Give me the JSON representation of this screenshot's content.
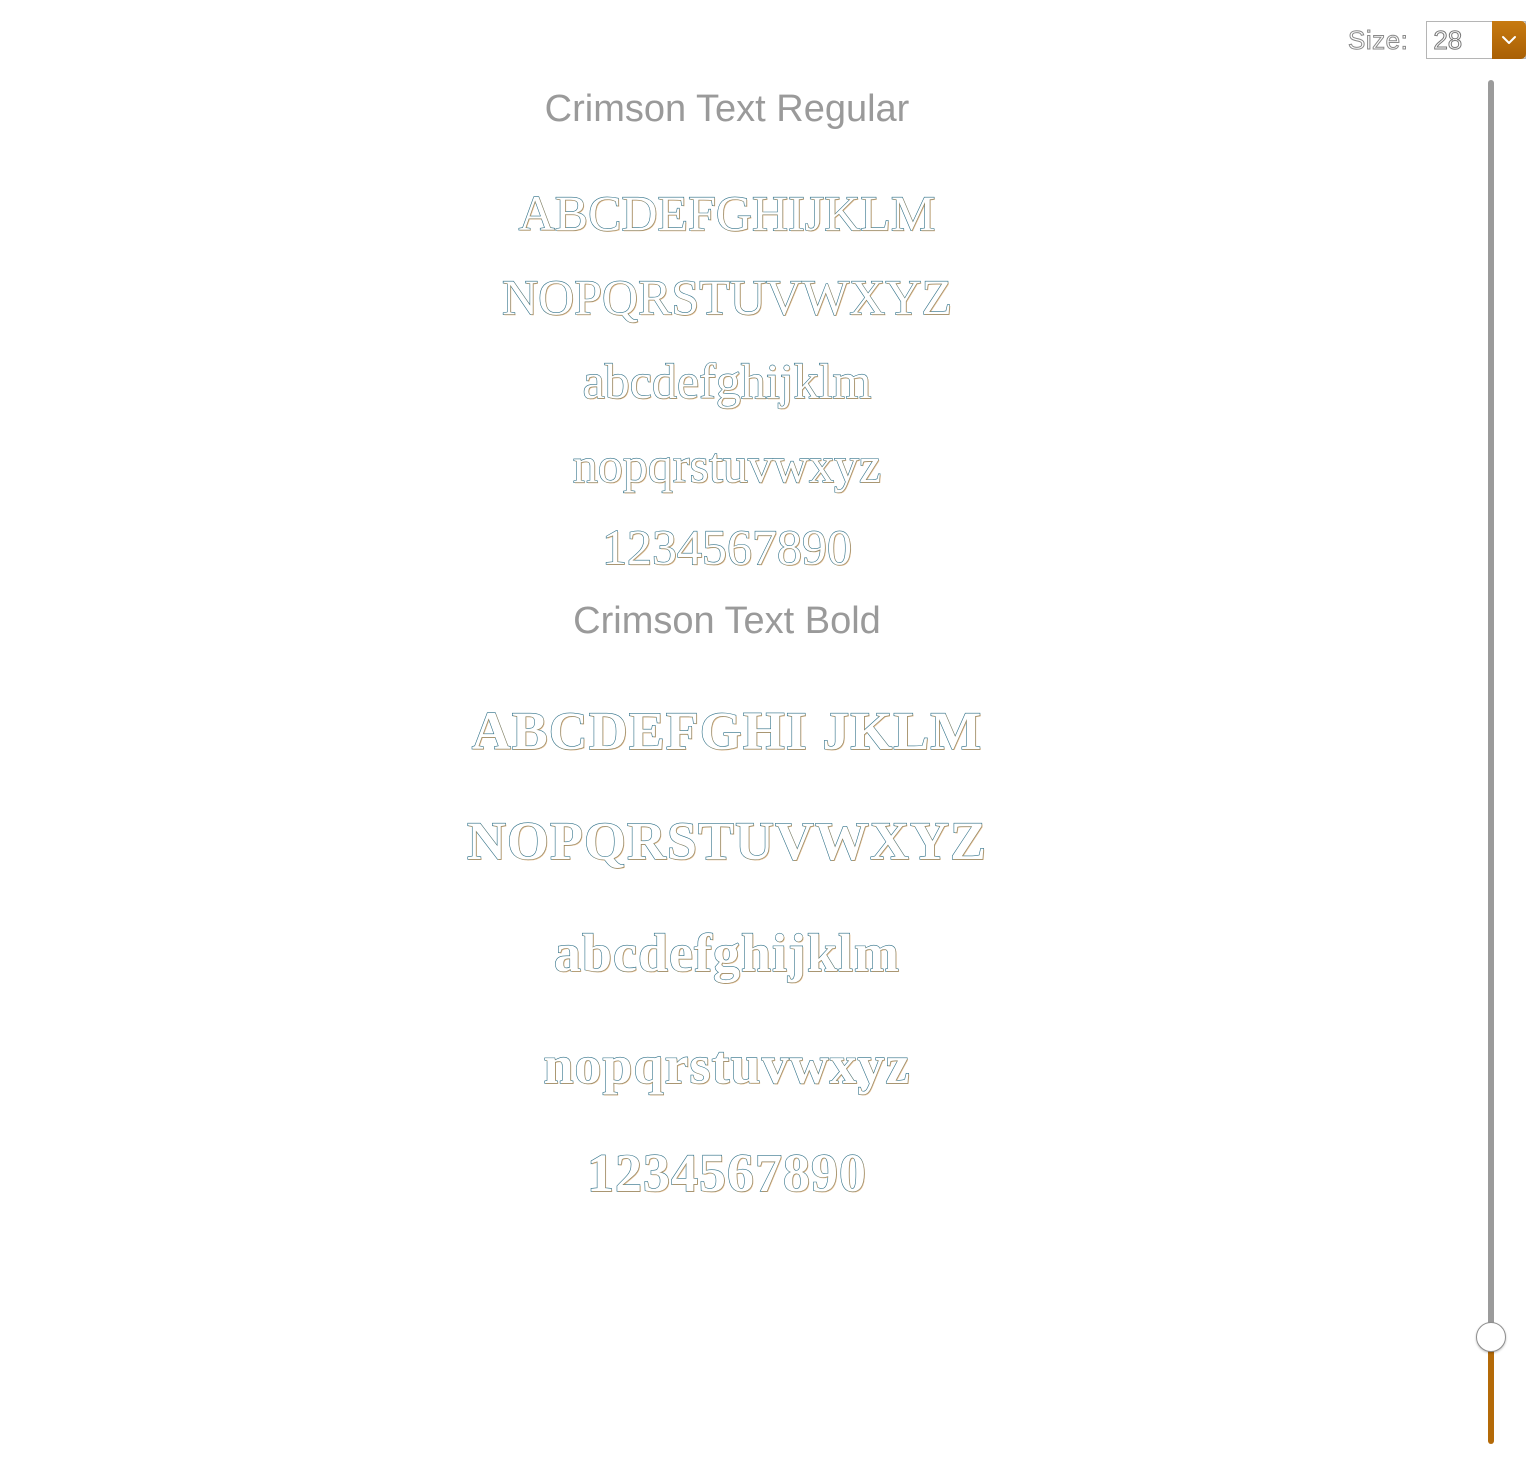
{
  "size_control": {
    "label": "Size:",
    "value": "28",
    "arrow_icon": "chevron-down-icon",
    "accent_color": "#b46a08"
  },
  "faces": [
    {
      "title": "Crimson Text Regular",
      "samples": [
        "ABCDEFGHIJKLM",
        "NOPQRSTUVWXYZ",
        "abcdefghijklm",
        "nopqrstuvwxyz",
        "1234567890"
      ]
    },
    {
      "title": "Crimson Text Bold",
      "samples": [
        "ABCDEFGHI JKLM",
        "NOPQRSTUVWXYZ",
        "abcdefghijklm",
        "nopqrstuvwxyz",
        "1234567890"
      ]
    }
  ],
  "slider": {
    "track_color": "#9b9b9b",
    "fill_color": "#b46a08",
    "level_fraction": 0.08
  }
}
